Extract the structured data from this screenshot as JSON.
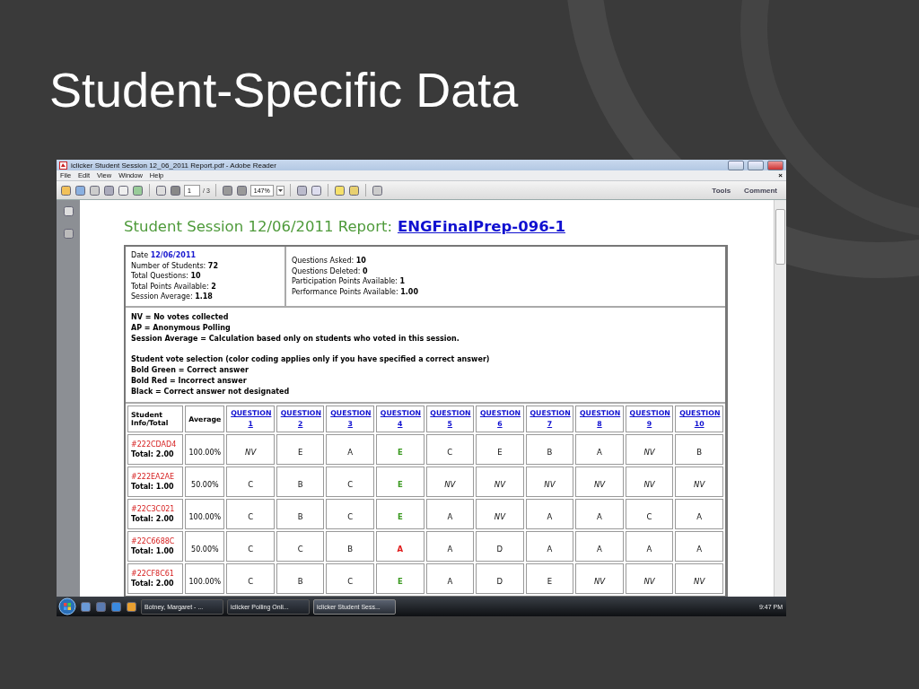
{
  "slide": {
    "title": "Student-Specific Data"
  },
  "window": {
    "title": "iclicker Student Session 12_06_2011 Report.pdf - Adobe Reader",
    "menu": [
      "File",
      "Edit",
      "View",
      "Window",
      "Help"
    ],
    "close_mark": "×",
    "toolbar": {
      "page": "1",
      "page_count": "/ 3",
      "zoom": "147%",
      "panels": [
        "Tools",
        "Comment"
      ]
    }
  },
  "report": {
    "title": "Student Session 12/06/2011 Report:",
    "link": "ENGFinalPrep-096-1",
    "summary_left": [
      {
        "label": "Date",
        "value": "12/06/2011",
        "linked": true
      },
      {
        "label": "Number of Students:",
        "value": "72",
        "linked": false
      },
      {
        "label": "Total Questions:",
        "value": "10",
        "linked": false
      },
      {
        "label": "Total Points Available:",
        "value": "2",
        "linked": false
      },
      {
        "label": "Session Average:",
        "value": "1.18",
        "linked": false
      }
    ],
    "summary_right": [
      {
        "label": "Questions Asked:",
        "value": "10",
        "linked": false
      },
      {
        "label": "Questions Deleted:",
        "value": "0",
        "linked": false
      },
      {
        "label": "Participation Points Available:",
        "value": "1",
        "linked": false
      },
      {
        "label": "Performance Points Available:",
        "value": "1.00",
        "linked": false
      }
    ],
    "legend": [
      [
        "NV = No votes collected",
        "AP = Anonymous Polling",
        "Session Average = Calculation based only on students who voted in this session."
      ],
      [
        "Student vote selection (color coding applies only if you have specified a correct answer)",
        "Bold Green = Correct answer",
        "Bold Red = Incorrect answer",
        "Black = Correct answer not designated"
      ]
    ],
    "grid": {
      "columns": [
        "Student Info/Total",
        "Average"
      ],
      "questions": [
        "QUESTION 1",
        "QUESTION 2",
        "QUESTION 3",
        "QUESTION 4",
        "QUESTION 5",
        "QUESTION 6",
        "QUESTION 7",
        "QUESTION 8",
        "QUESTION 9",
        "QUESTION 10"
      ],
      "rows": [
        {
          "id": "#222CDAD4",
          "total": "Total: 2.00",
          "average": "100.00%",
          "answers": [
            {
              "text": "NV",
              "kind": "no_vote"
            },
            {
              "text": "E",
              "kind": "none"
            },
            {
              "text": "A",
              "kind": "none"
            },
            {
              "text": "E",
              "kind": "correct"
            },
            {
              "text": "C",
              "kind": "none"
            },
            {
              "text": "E",
              "kind": "none"
            },
            {
              "text": "B",
              "kind": "none"
            },
            {
              "text": "A",
              "kind": "none"
            },
            {
              "text": "NV",
              "kind": "no_vote"
            },
            {
              "text": "B",
              "kind": "none"
            }
          ]
        },
        {
          "id": "#222EA2AE",
          "total": "Total: 1.00",
          "average": "50.00%",
          "answers": [
            {
              "text": "C",
              "kind": "none"
            },
            {
              "text": "B",
              "kind": "none"
            },
            {
              "text": "C",
              "kind": "none"
            },
            {
              "text": "E",
              "kind": "correct"
            },
            {
              "text": "NV",
              "kind": "no_vote"
            },
            {
              "text": "NV",
              "kind": "no_vote"
            },
            {
              "text": "NV",
              "kind": "no_vote"
            },
            {
              "text": "NV",
              "kind": "no_vote"
            },
            {
              "text": "NV",
              "kind": "no_vote"
            },
            {
              "text": "NV",
              "kind": "no_vote"
            }
          ]
        },
        {
          "id": "#22C3C021",
          "total": "Total: 2.00",
          "average": "100.00%",
          "answers": [
            {
              "text": "C",
              "kind": "none"
            },
            {
              "text": "B",
              "kind": "none"
            },
            {
              "text": "C",
              "kind": "none"
            },
            {
              "text": "E",
              "kind": "correct"
            },
            {
              "text": "A",
              "kind": "none"
            },
            {
              "text": "NV",
              "kind": "no_vote"
            },
            {
              "text": "A",
              "kind": "none"
            },
            {
              "text": "A",
              "kind": "none"
            },
            {
              "text": "C",
              "kind": "none"
            },
            {
              "text": "A",
              "kind": "none"
            }
          ]
        },
        {
          "id": "#22C6688C",
          "total": "Total: 1.00",
          "average": "50.00%",
          "answers": [
            {
              "text": "C",
              "kind": "none"
            },
            {
              "text": "C",
              "kind": "none"
            },
            {
              "text": "B",
              "kind": "none"
            },
            {
              "text": "A",
              "kind": "incorrect"
            },
            {
              "text": "A",
              "kind": "none"
            },
            {
              "text": "D",
              "kind": "none"
            },
            {
              "text": "A",
              "kind": "none"
            },
            {
              "text": "A",
              "kind": "none"
            },
            {
              "text": "A",
              "kind": "none"
            },
            {
              "text": "A",
              "kind": "none"
            }
          ]
        },
        {
          "id": "#22CF8C61",
          "total": "Total: 2.00",
          "average": "100.00%",
          "answers": [
            {
              "text": "C",
              "kind": "none"
            },
            {
              "text": "B",
              "kind": "none"
            },
            {
              "text": "C",
              "kind": "none"
            },
            {
              "text": "E",
              "kind": "correct"
            },
            {
              "text": "A",
              "kind": "none"
            },
            {
              "text": "D",
              "kind": "none"
            },
            {
              "text": "E",
              "kind": "none"
            },
            {
              "text": "NV",
              "kind": "no_vote"
            },
            {
              "text": "NV",
              "kind": "no_vote"
            },
            {
              "text": "NV",
              "kind": "no_vote"
            }
          ]
        }
      ]
    }
  },
  "taskbar": {
    "tasks": [
      {
        "label": "Botney, Margaret - ...",
        "selected": false
      },
      {
        "label": "iclicker Polling Onli...",
        "selected": false
      },
      {
        "label": "iclicker Student Sess...",
        "selected": true
      }
    ],
    "clock": "9:47 PM"
  }
}
